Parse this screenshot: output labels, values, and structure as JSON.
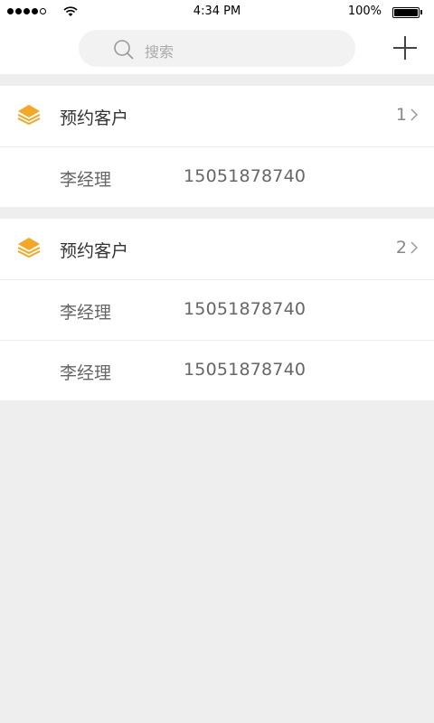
{
  "status_bar": {
    "time": "4:34 PM",
    "battery_text": "100%",
    "signal_dots_filled": 4,
    "signal_dots_total": 5,
    "battery_level": 1.0
  },
  "search": {
    "placeholder": "搜索"
  },
  "icons": {
    "search": "search-icon",
    "add": "plus-icon",
    "group": "layers-icon",
    "chevron": "chevron-right-icon"
  },
  "colors": {
    "accent": "#f5a623",
    "background": "#eeeeee"
  },
  "groups": [
    {
      "title": "预约客户",
      "count": "1",
      "contacts": [
        {
          "name": "李经理",
          "phone": "15051878740"
        }
      ]
    },
    {
      "title": "预约客户",
      "count": "2",
      "contacts": [
        {
          "name": "李经理",
          "phone": "15051878740"
        },
        {
          "name": "李经理",
          "phone": "15051878740"
        }
      ]
    }
  ]
}
